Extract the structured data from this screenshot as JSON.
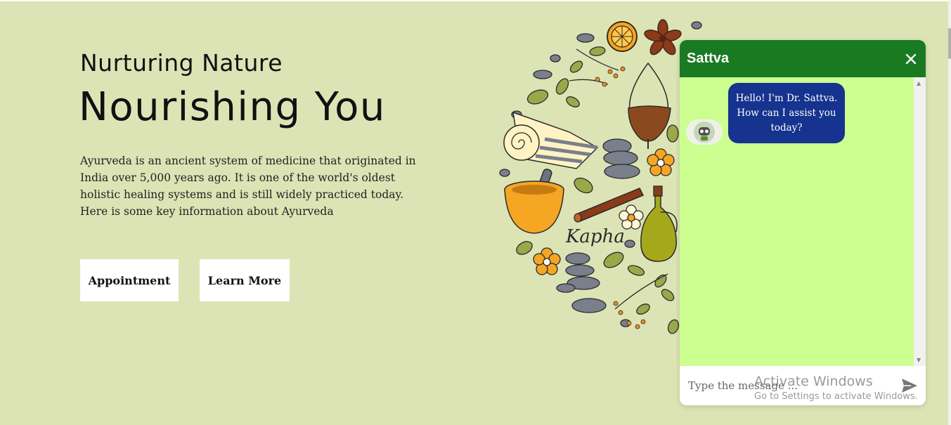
{
  "hero": {
    "subtitle": "Nurturing Nature",
    "title": "Nourishing You",
    "description": "Ayurveda is an ancient system of medicine that originated in India over 5,000 years ago. It is one of the world's oldest holistic healing systems and is still widely practiced today. Here is some key information about Ayurveda",
    "buttons": {
      "appointment": "Appointment",
      "learn_more": "Learn More"
    }
  },
  "illustration": {
    "label": "Kapha"
  },
  "chat": {
    "title": "Sattva",
    "close_icon": "close-icon",
    "messages": [
      {
        "sender": "bot",
        "avatar_icon": "robot-icon",
        "text": "Hello! I'm Dr. Sattva. How can I assist you today?"
      }
    ],
    "input": {
      "value": "",
      "placeholder": "Type the message ..."
    },
    "send_icon": "send-icon"
  },
  "watermark": {
    "title": "Activate Windows",
    "subtitle": "Go to Settings to activate Windows."
  },
  "colors": {
    "page_bg": "#dce4b5",
    "chat_header": "#1a7a22",
    "chat_body": "#ccff90",
    "bot_bubble": "#15338f"
  }
}
